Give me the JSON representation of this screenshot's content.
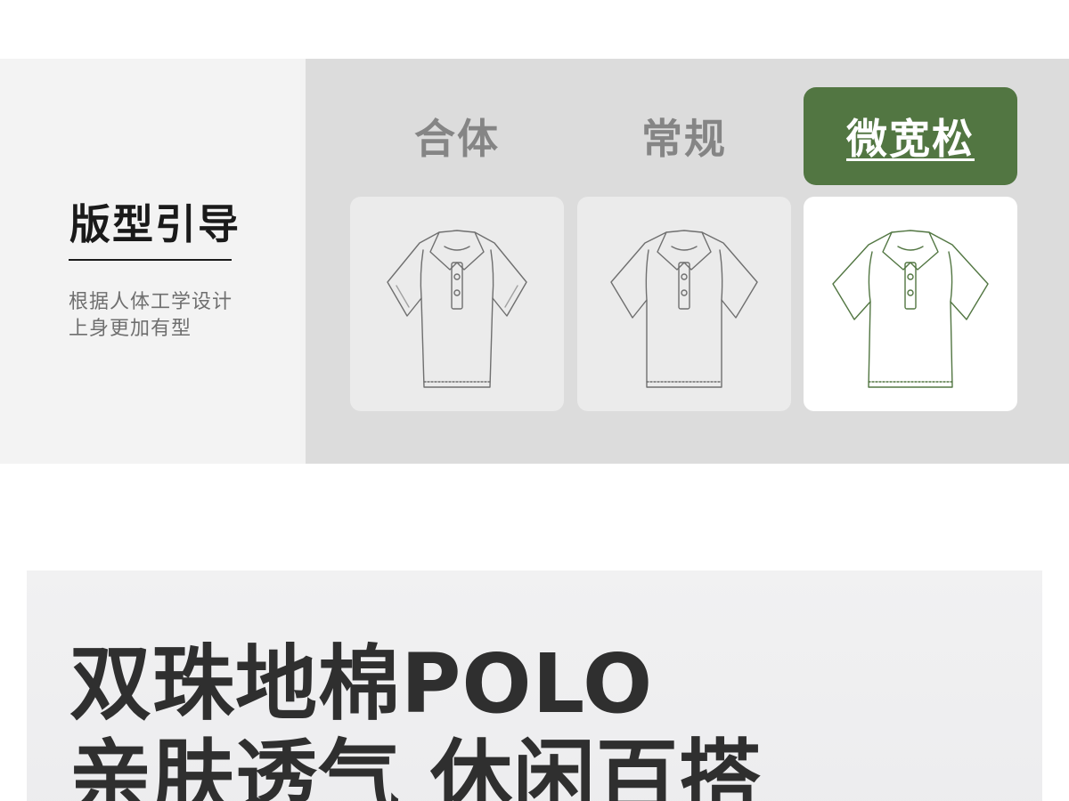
{
  "fit_guide": {
    "title": "版型引导",
    "description_lines": [
      "根据人体工学设计",
      "上身更加有型"
    ],
    "options": [
      {
        "label": "合体",
        "selected": false
      },
      {
        "label": "常规",
        "selected": false
      },
      {
        "label": "微宽松",
        "selected": true
      }
    ],
    "shirt_icon": "polo-shirt-icon",
    "colors": {
      "selected_bg": "#527642",
      "panel_bg": "#dcdcdc",
      "outline_default": "#6f6f6f",
      "outline_selected": "#527642"
    }
  },
  "banner": {
    "line1": "双珠地棉POLO",
    "line2": "亲肤透气 休闲百搭"
  }
}
